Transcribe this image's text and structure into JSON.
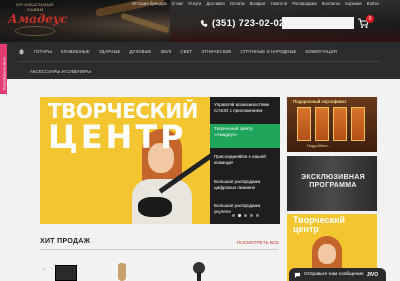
{
  "header": {
    "logo_top": "МУЗЫКАЛЬНЫЕ ЛАВКИ",
    "logo_main": "Амадеус",
    "top_nav": [
      "История брендов",
      "О нас",
      "Услуги",
      "Доставка",
      "Оплата",
      "Возврат",
      "Новости",
      "Распродажа",
      "Контакты",
      "Корзина",
      "Войти"
    ],
    "phone": "(351) 723-02-02",
    "search_placeholder": "",
    "cart_count": "0"
  },
  "menu": {
    "row1": [
      "ГИТАРЫ",
      "КЛАВИШНЫЕ",
      "УДАРНЫЕ",
      "ДУХОВЫЕ",
      "ЗВУК",
      "СВЕТ",
      "ЭТНИЧЕСКИЕ",
      "СТРУННЫЕ И НАРОДНЫЕ",
      "КОММУТАЦИЯ"
    ],
    "row2": [
      "АКСЕССУАРЫ И СУВЕНИРЫ"
    ]
  },
  "side_tab": "Перезвоните мне!",
  "hero": {
    "title_line1": "ТВОРЧЕСКИЙ",
    "title_line2": "ЦЕНТР",
    "list": [
      {
        "label": "Управляй возможностями CASIO с приложением",
        "active": false
      },
      {
        "label": "Творческий Центр «Амадеус»",
        "active": true
      },
      {
        "label": "Присоединяйся к нашей команде!",
        "active": false
      },
      {
        "label": "Большая распродажа цифровых пианино",
        "active": false
      },
      {
        "label": "Большая распродажа укулеле",
        "active": false
      }
    ]
  },
  "right_banners": {
    "b1_title": "Подарочный сертификат",
    "b1_more": "Подробнее...",
    "b2_text": "ЭКСКЛЮЗИВНАЯ ПРОГРАММА",
    "b3_title_line1": "Творческий",
    "b3_title_line2": "центр"
  },
  "hits": {
    "title": "ХИТ ПРОДАЖ",
    "see_all": "ПОСМОТРЕТЬ ВСЕ"
  },
  "chat": {
    "label": "Отправьте нам сообщение",
    "brand": "JIVO"
  },
  "colors": {
    "accent_green": "#1fa55c",
    "accent_red": "#e01b22",
    "banner_yellow": "#f2c531",
    "side_pink": "#e23c71"
  }
}
